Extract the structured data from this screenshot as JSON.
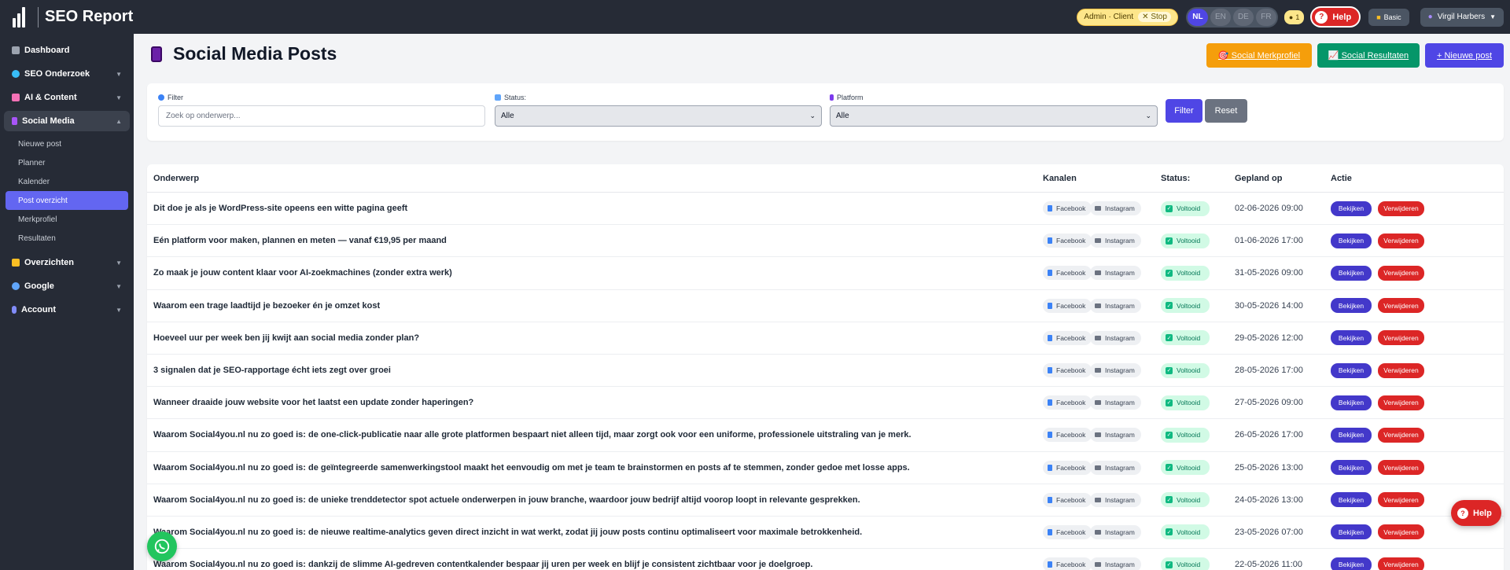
{
  "app": {
    "title": "SEO Report"
  },
  "topbar": {
    "admin_label": "Admin · Client",
    "stop_label": "✕ Stop",
    "languages": [
      "NL",
      "EN",
      "DE",
      "FR"
    ],
    "active_language": "NL",
    "credits": "1",
    "help_label": "Help",
    "plan_label": "Basic",
    "user_name": "Virgil Harbers",
    "user_chevron": "▼"
  },
  "sidebar": {
    "items": [
      {
        "label": "Dashboard",
        "color": "#9ca3af"
      },
      {
        "label": "SEO Onderzoek",
        "color": "#38bdf8",
        "chevron": "▼"
      },
      {
        "label": "AI & Content",
        "color": "#f472b6",
        "chevron": "▼"
      },
      {
        "label": "Social Media",
        "color": "#a855f7",
        "chevron": "▲"
      },
      {
        "label": "Overzichten",
        "color": "#fbbf24",
        "chevron": "▼"
      },
      {
        "label": "Google",
        "color": "#60a5fa",
        "chevron": "▼"
      },
      {
        "label": "Account",
        "color": "#818cf8",
        "chevron": "▼"
      }
    ],
    "social_sub": [
      "Nieuwe post",
      "Planner",
      "Kalender",
      "Post overzicht",
      "Merkprofiel",
      "Resultaten"
    ],
    "active_sub": "Post overzicht"
  },
  "page": {
    "title": "Social Media Posts",
    "buttons": {
      "merkprofiel": "🎯 Social Merkprofiel",
      "resultaten": "📈 Social Resultaten",
      "nieuwe": "+ Nieuwe post"
    }
  },
  "filters": {
    "filter_label": "Filter",
    "filter_placeholder": "Zoek op onderwerp...",
    "status_label": "Status:",
    "status_value": "Alle",
    "platform_label": "Platform",
    "platform_value": "Alle",
    "filter_button": "Filter",
    "reset_button": "Reset"
  },
  "table": {
    "headers": {
      "subject": "Onderwerp",
      "channels": "Kanalen",
      "status": "Status:",
      "planned": "Gepland op",
      "action": "Actie"
    },
    "channel_labels": {
      "facebook": "Facebook",
      "instagram": "Instagram"
    },
    "status_label": "Voltooid",
    "view_label": "Bekijken",
    "delete_label": "Verwijderen",
    "rows": [
      {
        "subject": "Dit doe je als je WordPress-site opeens een witte pagina geeft",
        "date": "02-06-2026 09:00"
      },
      {
        "subject": "Eén platform voor maken, plannen en meten — vanaf €19,95 per maand",
        "date": "01-06-2026 17:00"
      },
      {
        "subject": "Zo maak je jouw content klaar voor AI-zoekmachines (zonder extra werk)",
        "date": "31-05-2026 09:00"
      },
      {
        "subject": "Waarom een trage laadtijd je bezoeker én je omzet kost",
        "date": "30-05-2026 14:00"
      },
      {
        "subject": "Hoeveel uur per week ben jij kwijt aan social media zonder plan?",
        "date": "29-05-2026 12:00"
      },
      {
        "subject": "3 signalen dat je SEO-rapportage écht iets zegt over groei",
        "date": "28-05-2026 17:00"
      },
      {
        "subject": "Wanneer draaide jouw website voor het laatst een update zonder haperingen?",
        "date": "27-05-2026 09:00"
      },
      {
        "subject": "Waarom Social4you.nl nu zo goed is: de one-click-publicatie naar alle grote platformen bespaart niet alleen tijd, maar zorgt ook voor een uniforme, professionele uitstraling van je merk.",
        "date": "26-05-2026 17:00"
      },
      {
        "subject": "Waarom Social4you.nl nu zo goed is: de geïntegreerde samenwerkingstool maakt het eenvoudig om met je team te brainstormen en posts af te stemmen, zonder gedoe met losse apps.",
        "date": "25-05-2026 13:00"
      },
      {
        "subject": "Waarom Social4you.nl nu zo goed is: de unieke trenddetector spot actuele onderwerpen in jouw branche, waardoor jouw bedrijf altijd voorop loopt in relevante gesprekken.",
        "date": "24-05-2026 13:00"
      },
      {
        "subject": "Waarom Social4you.nl nu zo goed is: de nieuwe realtime-analytics geven direct inzicht in wat werkt, zodat jij jouw posts continu optimaliseert voor maximale betrokkenheid.",
        "date": "23-05-2026 07:00"
      },
      {
        "subject": "Waarom Social4you.nl nu zo goed is: dankzij de slimme AI-gedreven contentkalender bespaar jij uren per week en blijf je consistent zichtbaar voor je doelgroep.",
        "date": "22-05-2026 11:00"
      }
    ]
  },
  "floating": {
    "help_label": "Help"
  }
}
